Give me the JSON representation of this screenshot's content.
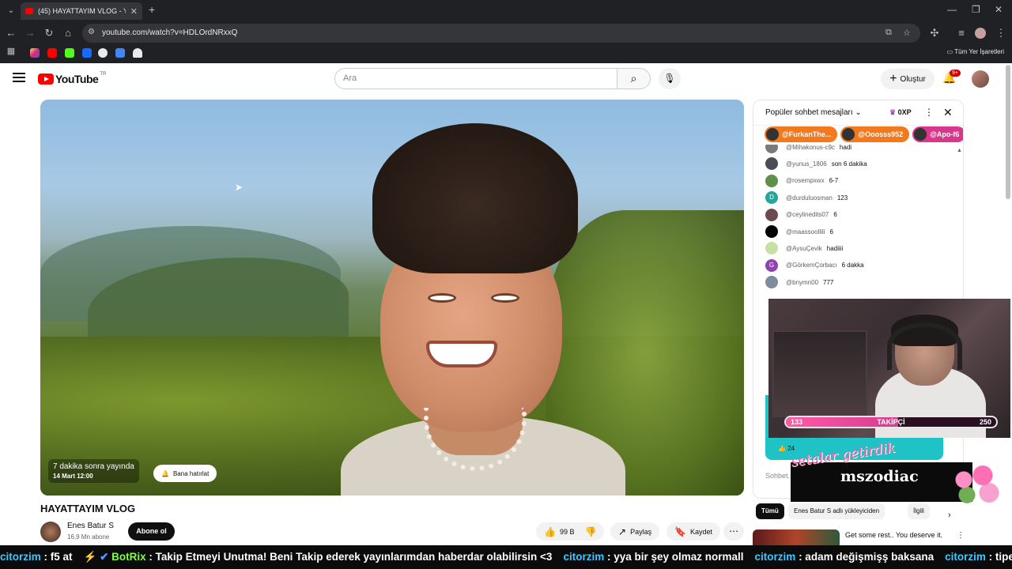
{
  "browser": {
    "tab_title": "(45) HAYATTAYIM VLOG - YouTu",
    "url": "youtube.com/watch?v=HDLOrdNRxxQ",
    "bookmarks_all": "Tüm Yer İşaretleri"
  },
  "header": {
    "logo_text": "YouTube",
    "logo_region": "TR",
    "search_placeholder": "Ara",
    "create_label": "Oluştur",
    "notif_count": "9+"
  },
  "video": {
    "premiere_text": "7 dakika sonra yayında",
    "premiere_date": "14 Mart 12:00",
    "remind_label": "Bana hatırlat",
    "title": "HAYATTAYIM VLOG",
    "channel": "Enes Batur S",
    "subscribers": "16,9 Mn abone",
    "subscribe_label": "Abone ol",
    "likes": "99 B",
    "share_label": "Paylaş",
    "save_label": "Kaydet"
  },
  "chat": {
    "mode": "Popüler sohbet mesajları",
    "xp": "0XP",
    "pinned": [
      {
        "name": "@FurkanThe...",
        "color": "#f2791e"
      },
      {
        "name": "@Ooosss952",
        "color": "#f2791e"
      },
      {
        "name": "@Apo-f6",
        "color": "#d8378b"
      }
    ],
    "messages": [
      {
        "user": "@Mihakonus-c9c",
        "text": "hadi",
        "avatar": "#7a7a7a",
        "initial": ""
      },
      {
        "user": "@yunus_1806",
        "text": "son 6 dakika",
        "avatar": "#4b4f55",
        "initial": ""
      },
      {
        "user": "@rosempxwx",
        "text": "6-7",
        "avatar": "#5f8f4a",
        "initial": ""
      },
      {
        "user": "@durduluosman",
        "text": "123",
        "avatar": "#26a69a",
        "initial": "D"
      },
      {
        "user": "@ceylinedits07",
        "text": "6",
        "avatar": "#6b4b50",
        "initial": ""
      },
      {
        "user": "@maassoollili",
        "text": "6",
        "avatar": "#050505",
        "initial": ""
      },
      {
        "user": "@AysuÇevik",
        "text": "hadiiii",
        "avatar": "#c5e1a5",
        "initial": ""
      },
      {
        "user": "@GörkemÇorbacı",
        "text": "6 dakka",
        "avatar": "#8e44ad",
        "initial": "G"
      },
      {
        "user": "@bnymn00",
        "text": "777",
        "avatar": "#7f8c9d",
        "initial": ""
      }
    ],
    "input_placeholder": "Sohbet..."
  },
  "stream_overlay": {
    "followers_current": "133",
    "followers_label": "TAKİPÇİ",
    "followers_goal": "250",
    "followers_progress": 0.532,
    "like_count": "24",
    "script_text": "setalar getirdik",
    "brand": "mszodiac"
  },
  "related": {
    "chips": [
      "Tümü",
      "Enes Batur S adlı yükleyiciden",
      "İlgili"
    ],
    "first_title": "Get some rest.. You deserve it."
  },
  "ticker": {
    "segments": [
      {
        "user": "citorzim",
        "text": ": f5 at"
      },
      {
        "user": "BotRix",
        "text": ": Takip Etmeyi Unutma! Beni Takip ederek yayınlarımdan haberdar olabilirsin <3",
        "bot": true
      },
      {
        "user": "citorzim",
        "text": ": yya bir şey olmaz normall"
      },
      {
        "user": "citorzim",
        "text": ": adam değişmişş baksana"
      },
      {
        "user": "citorzim",
        "text": ": tipe"
      }
    ]
  }
}
